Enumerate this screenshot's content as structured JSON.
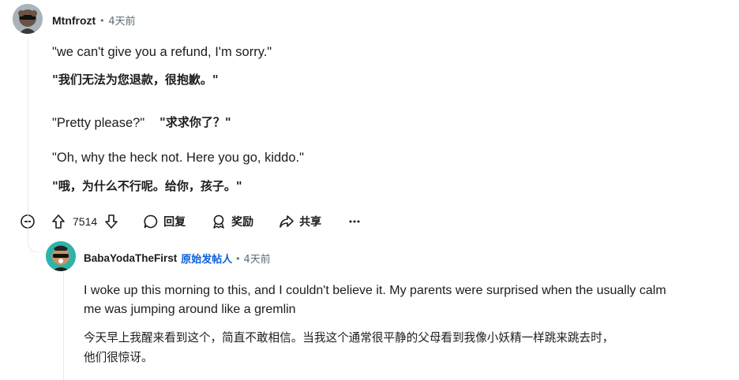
{
  "comment": {
    "author": "Mtnfrozt",
    "time": "4天前",
    "lines": [
      {
        "text": "\"we can't give you a refund, I'm sorry.\"",
        "style": "en"
      },
      {
        "text": "\"我们无法为您退款，很抱歉。\"",
        "style": "zh"
      },
      {
        "text": "\"Pretty please?\"",
        "style": "en"
      },
      {
        "text": "\"求求你了？\"",
        "style": "zh"
      },
      {
        "text": "\"Oh, why the heck not. Here you go, kiddo.\"",
        "style": "en"
      },
      {
        "text": "\"哦，为什么不行呢。给你，孩子。\"",
        "style": "zh"
      }
    ],
    "actions": {
      "upvote_icon": "arrow-up-icon",
      "score": "7514",
      "downvote_icon": "arrow-down-icon",
      "reply_label": "回复",
      "award_label": "奖励",
      "share_label": "共享",
      "more_icon": "ellipsis-icon"
    }
  },
  "reply": {
    "author": "BabaYodaTheFirst",
    "op_badge": "原始发帖人",
    "time": "4天前",
    "body_en_1": "I woke up this morning to this, and I couldn't believe it. My parents were surprised when the usually calm",
    "body_en_2": "me was jumping around like a gremlin",
    "body_zh_1": "今天早上我醒来看到这个，简直不敢相信。当我这个通常很平静的父母看到我像小妖精一样跳来跳去时，",
    "body_zh_2": "他们很惊讶。"
  },
  "colors": {
    "op_blue": "#0a5fd6",
    "meta_gray": "#5c6c74",
    "thread_line": "#e5ebee"
  }
}
